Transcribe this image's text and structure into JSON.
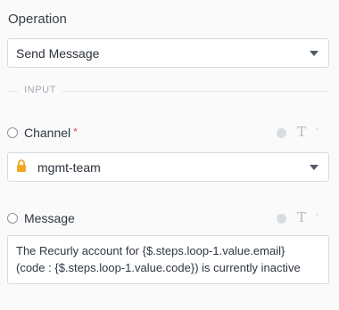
{
  "operation": {
    "label": "Operation",
    "value": "Send Message"
  },
  "input_section": {
    "label": "INPUT"
  },
  "channel": {
    "label": "Channel",
    "required_mark": "*",
    "value": "mgmt-team",
    "type_icon": "T",
    "chevron": "ˇ"
  },
  "message": {
    "label": "Message",
    "type_icon": "T",
    "chevron": "ˇ",
    "line1": "The Recurly account for {$.steps.loop-1.value.email}",
    "line2": "(code : {$.steps.loop-1.value.code}) is currently inactive"
  },
  "icons": {
    "lock": "lock-icon",
    "caret": "caret-down-icon"
  },
  "colors": {
    "lock": "#f0a824",
    "required": "#e0464e"
  }
}
